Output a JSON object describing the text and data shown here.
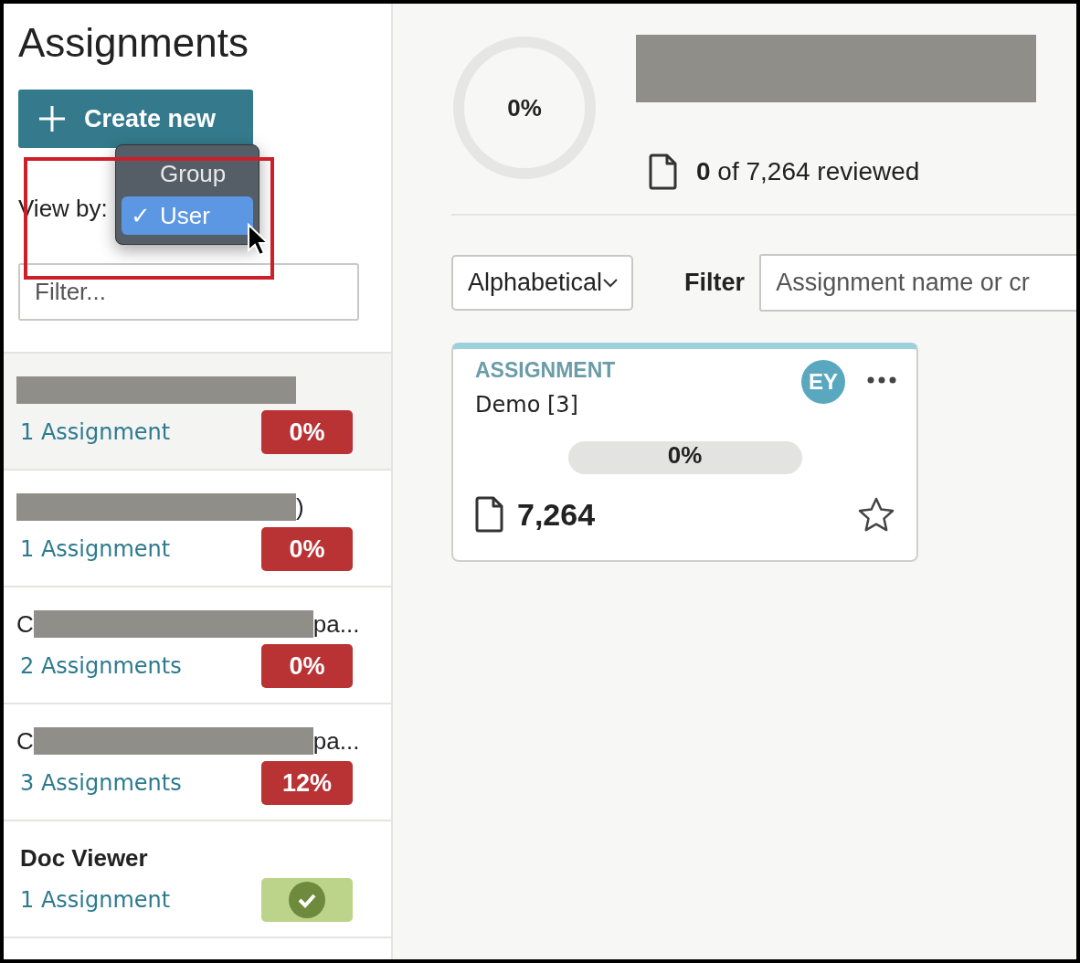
{
  "sidebar": {
    "title": "Assignments",
    "create_button": "Create new",
    "view_by": {
      "label": "View by:",
      "options": [
        {
          "label": "Group",
          "selected": false
        },
        {
          "label": "User",
          "selected": true,
          "mark": "✓"
        }
      ]
    },
    "filter": {
      "placeholder": "Filter..."
    },
    "groups": [
      {
        "kind": "redacted",
        "count": "1 Assignment",
        "badge": {
          "kind": "percent",
          "text": "0%",
          "color": "#b93234"
        },
        "selected": true
      },
      {
        "kind": "redacted",
        "name_tail": ")",
        "count": "1 Assignment",
        "badge": {
          "kind": "percent",
          "text": "0%",
          "color": "#b93234"
        },
        "selected": false
      },
      {
        "kind": "redacted",
        "name_head": "C",
        "name_tail": "pa...",
        "count": "2 Assignments",
        "badge": {
          "kind": "percent",
          "text": "0%",
          "color": "#b93234"
        },
        "selected": false
      },
      {
        "kind": "redacted",
        "name_head": "C",
        "name_tail": "pa...",
        "count": "3 Assignments",
        "badge": {
          "kind": "percent",
          "text": "12%",
          "color": "#b93234"
        },
        "selected": false
      },
      {
        "kind": "plain",
        "name_head": "Doc Viewer",
        "count": "1 Assignment",
        "badge": {
          "kind": "complete",
          "color": "#bcd48a"
        },
        "selected": false
      }
    ]
  },
  "summary": {
    "progress": {
      "text": "0%",
      "level": 0
    },
    "reviewed": "**0** of 7,264 reviewed"
  },
  "toolbar": {
    "sort": "Alphabetical",
    "filter_label": "Filter",
    "filter_placeholder": "Assignment name or cr"
  },
  "cards": [
    {
      "type": "ASSIGNMENT",
      "name": "Demo [3]",
      "avatar": "EY",
      "progress": {
        "text": "0%",
        "level": 0
      },
      "documents": "7,264",
      "starred": false
    }
  ]
}
